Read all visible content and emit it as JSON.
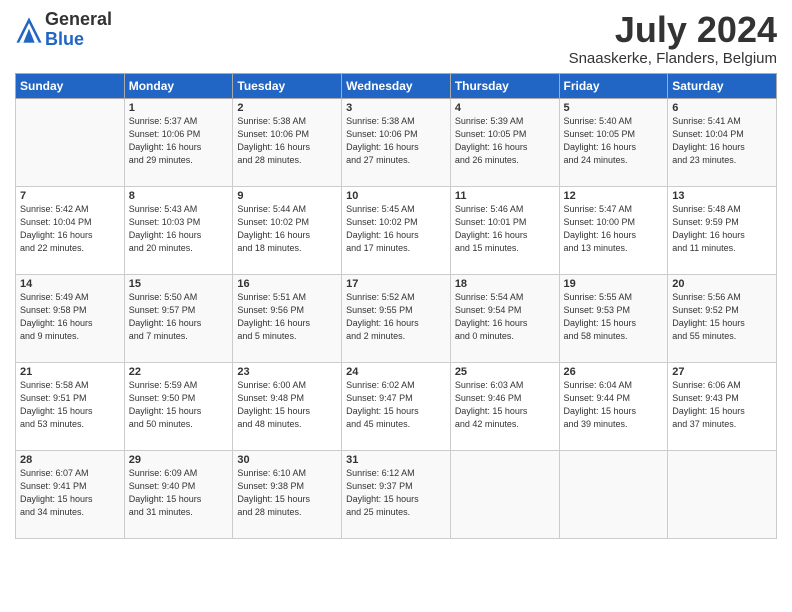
{
  "logo": {
    "general": "General",
    "blue": "Blue"
  },
  "title": "July 2024",
  "location": "Snaaskerke, Flanders, Belgium",
  "days_of_week": [
    "Sunday",
    "Monday",
    "Tuesday",
    "Wednesday",
    "Thursday",
    "Friday",
    "Saturday"
  ],
  "weeks": [
    [
      {
        "day": "",
        "info": ""
      },
      {
        "day": "1",
        "info": "Sunrise: 5:37 AM\nSunset: 10:06 PM\nDaylight: 16 hours\nand 29 minutes."
      },
      {
        "day": "2",
        "info": "Sunrise: 5:38 AM\nSunset: 10:06 PM\nDaylight: 16 hours\nand 28 minutes."
      },
      {
        "day": "3",
        "info": "Sunrise: 5:38 AM\nSunset: 10:06 PM\nDaylight: 16 hours\nand 27 minutes."
      },
      {
        "day": "4",
        "info": "Sunrise: 5:39 AM\nSunset: 10:05 PM\nDaylight: 16 hours\nand 26 minutes."
      },
      {
        "day": "5",
        "info": "Sunrise: 5:40 AM\nSunset: 10:05 PM\nDaylight: 16 hours\nand 24 minutes."
      },
      {
        "day": "6",
        "info": "Sunrise: 5:41 AM\nSunset: 10:04 PM\nDaylight: 16 hours\nand 23 minutes."
      }
    ],
    [
      {
        "day": "7",
        "info": "Sunrise: 5:42 AM\nSunset: 10:04 PM\nDaylight: 16 hours\nand 22 minutes."
      },
      {
        "day": "8",
        "info": "Sunrise: 5:43 AM\nSunset: 10:03 PM\nDaylight: 16 hours\nand 20 minutes."
      },
      {
        "day": "9",
        "info": "Sunrise: 5:44 AM\nSunset: 10:02 PM\nDaylight: 16 hours\nand 18 minutes."
      },
      {
        "day": "10",
        "info": "Sunrise: 5:45 AM\nSunset: 10:02 PM\nDaylight: 16 hours\nand 17 minutes."
      },
      {
        "day": "11",
        "info": "Sunrise: 5:46 AM\nSunset: 10:01 PM\nDaylight: 16 hours\nand 15 minutes."
      },
      {
        "day": "12",
        "info": "Sunrise: 5:47 AM\nSunset: 10:00 PM\nDaylight: 16 hours\nand 13 minutes."
      },
      {
        "day": "13",
        "info": "Sunrise: 5:48 AM\nSunset: 9:59 PM\nDaylight: 16 hours\nand 11 minutes."
      }
    ],
    [
      {
        "day": "14",
        "info": "Sunrise: 5:49 AM\nSunset: 9:58 PM\nDaylight: 16 hours\nand 9 minutes."
      },
      {
        "day": "15",
        "info": "Sunrise: 5:50 AM\nSunset: 9:57 PM\nDaylight: 16 hours\nand 7 minutes."
      },
      {
        "day": "16",
        "info": "Sunrise: 5:51 AM\nSunset: 9:56 PM\nDaylight: 16 hours\nand 5 minutes."
      },
      {
        "day": "17",
        "info": "Sunrise: 5:52 AM\nSunset: 9:55 PM\nDaylight: 16 hours\nand 2 minutes."
      },
      {
        "day": "18",
        "info": "Sunrise: 5:54 AM\nSunset: 9:54 PM\nDaylight: 16 hours\nand 0 minutes."
      },
      {
        "day": "19",
        "info": "Sunrise: 5:55 AM\nSunset: 9:53 PM\nDaylight: 15 hours\nand 58 minutes."
      },
      {
        "day": "20",
        "info": "Sunrise: 5:56 AM\nSunset: 9:52 PM\nDaylight: 15 hours\nand 55 minutes."
      }
    ],
    [
      {
        "day": "21",
        "info": "Sunrise: 5:58 AM\nSunset: 9:51 PM\nDaylight: 15 hours\nand 53 minutes."
      },
      {
        "day": "22",
        "info": "Sunrise: 5:59 AM\nSunset: 9:50 PM\nDaylight: 15 hours\nand 50 minutes."
      },
      {
        "day": "23",
        "info": "Sunrise: 6:00 AM\nSunset: 9:48 PM\nDaylight: 15 hours\nand 48 minutes."
      },
      {
        "day": "24",
        "info": "Sunrise: 6:02 AM\nSunset: 9:47 PM\nDaylight: 15 hours\nand 45 minutes."
      },
      {
        "day": "25",
        "info": "Sunrise: 6:03 AM\nSunset: 9:46 PM\nDaylight: 15 hours\nand 42 minutes."
      },
      {
        "day": "26",
        "info": "Sunrise: 6:04 AM\nSunset: 9:44 PM\nDaylight: 15 hours\nand 39 minutes."
      },
      {
        "day": "27",
        "info": "Sunrise: 6:06 AM\nSunset: 9:43 PM\nDaylight: 15 hours\nand 37 minutes."
      }
    ],
    [
      {
        "day": "28",
        "info": "Sunrise: 6:07 AM\nSunset: 9:41 PM\nDaylight: 15 hours\nand 34 minutes."
      },
      {
        "day": "29",
        "info": "Sunrise: 6:09 AM\nSunset: 9:40 PM\nDaylight: 15 hours\nand 31 minutes."
      },
      {
        "day": "30",
        "info": "Sunrise: 6:10 AM\nSunset: 9:38 PM\nDaylight: 15 hours\nand 28 minutes."
      },
      {
        "day": "31",
        "info": "Sunrise: 6:12 AM\nSunset: 9:37 PM\nDaylight: 15 hours\nand 25 minutes."
      },
      {
        "day": "",
        "info": ""
      },
      {
        "day": "",
        "info": ""
      },
      {
        "day": "",
        "info": ""
      }
    ]
  ]
}
